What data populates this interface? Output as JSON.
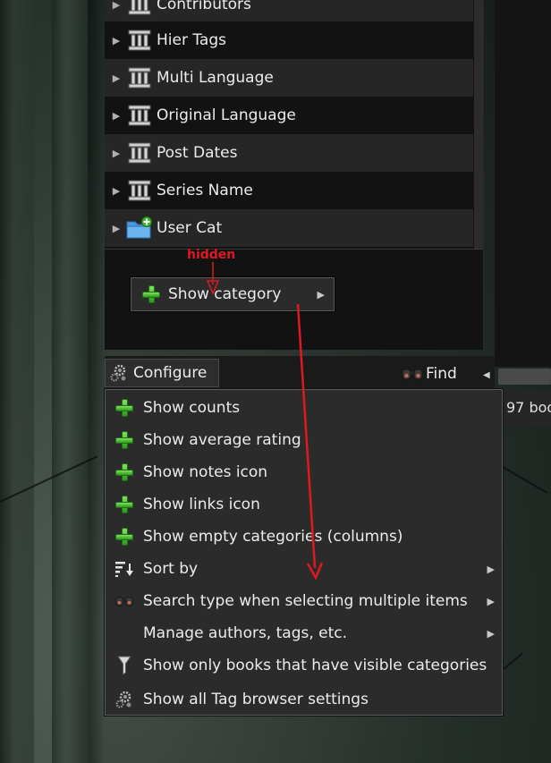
{
  "tag_browser": {
    "categories": [
      {
        "label": "Contributors",
        "icon": "column-icon"
      },
      {
        "label": "Hier Tags",
        "icon": "column-icon"
      },
      {
        "label": "Multi Language",
        "icon": "column-icon"
      },
      {
        "label": "Original Language",
        "icon": "column-icon"
      },
      {
        "label": "Post Dates",
        "icon": "column-icon"
      },
      {
        "label": "Series Name",
        "icon": "column-icon"
      },
      {
        "label": "User Cat",
        "icon": "folder-add-icon"
      }
    ],
    "hidden_annotation": "hidden",
    "show_category_label": "Show category",
    "configure_label": "Configure",
    "find_label": "Find",
    "status_text": "97 boo"
  },
  "configure_menu": {
    "items": [
      {
        "label": "Show counts",
        "icon": "plus-icon",
        "submenu": false
      },
      {
        "label": "Show average rating",
        "icon": "plus-icon",
        "submenu": false
      },
      {
        "label": "Show notes icon",
        "icon": "plus-icon",
        "submenu": false
      },
      {
        "label": "Show links icon",
        "icon": "plus-icon",
        "submenu": false
      },
      {
        "label": "Show empty categories (columns)",
        "icon": "plus-icon",
        "submenu": false
      },
      {
        "label": "Sort by",
        "icon": "sort-icon",
        "submenu": true
      },
      {
        "label": "Search type when selecting multiple items",
        "icon": "binoculars-icon",
        "submenu": true
      },
      {
        "label": "Manage authors, tags, etc.",
        "icon": "",
        "submenu": true
      },
      {
        "label": "Show only books that have visible categories",
        "icon": "filter-icon",
        "submenu": false
      },
      {
        "label": "Show all Tag browser settings",
        "icon": "config-icon",
        "submenu": false
      }
    ]
  },
  "colors": {
    "annotation_red": "#e0191f",
    "plus_green": "#3fb82a",
    "menu_bg": "#2b2b2b"
  }
}
